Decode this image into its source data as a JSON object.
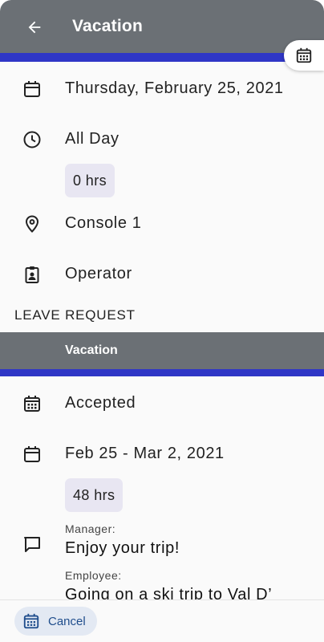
{
  "header": {
    "title": "Vacation"
  },
  "shift": {
    "date": "Thursday, February 25, 2021",
    "time": "All Day",
    "hours": "0 hrs",
    "location": "Console 1",
    "role": "Operator"
  },
  "leave_request": {
    "section_label": "LEAVE REQUEST",
    "type": "Vacation",
    "status": "Accepted",
    "date_range": "Feb 25 - Mar 2, 2021",
    "hours": "48 hrs",
    "manager_label": "Manager:",
    "manager_comment": "Enjoy your trip!",
    "employee_label": "Employee:",
    "employee_comment": "Going on a ski trip to Val D’"
  },
  "footer": {
    "cancel_label": "Cancel"
  },
  "colors": {
    "header_bg": "#6b7075",
    "accent": "#2f36c6",
    "chip_bg": "#e8e6f2",
    "cancel_bg": "#e3e9f3",
    "cancel_text": "#1f4d8c"
  }
}
